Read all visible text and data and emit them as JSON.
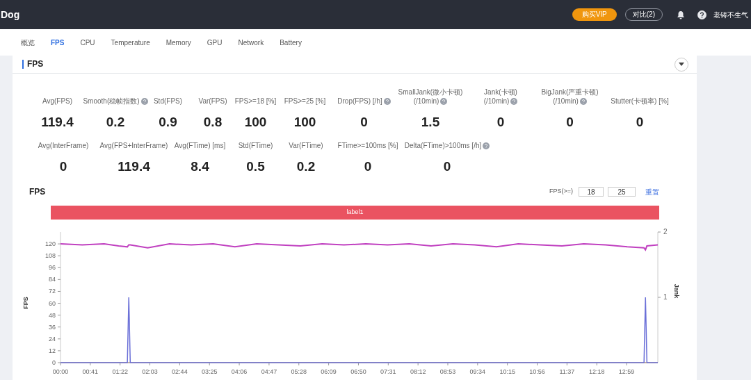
{
  "header": {
    "logo": "Dog",
    "buy_button": "购买VIP",
    "compare_button": "对比(2)",
    "user": "老铸不生气"
  },
  "tabs": [
    {
      "label": "概览",
      "selected": false
    },
    {
      "label": "FPS",
      "selected": true
    },
    {
      "label": "CPU",
      "selected": false
    },
    {
      "label": "Temperature",
      "selected": false
    },
    {
      "label": "Memory",
      "selected": false
    },
    {
      "label": "GPU",
      "selected": false
    },
    {
      "label": "Network",
      "selected": false
    },
    {
      "label": "Battery",
      "selected": false
    }
  ],
  "section": {
    "title": "FPS"
  },
  "stats_row_1": [
    {
      "label": "Avg(FPS)",
      "value": "119.4",
      "help": false
    },
    {
      "label": "Smooth(稳帧指数)",
      "value": "0.2",
      "help": true
    },
    {
      "label": "Std(FPS)",
      "value": "0.9",
      "help": false
    },
    {
      "label": "Var(FPS)",
      "value": "0.8",
      "help": false
    },
    {
      "label": "FPS>=18 [%]",
      "value": "100",
      "help": false
    },
    {
      "label": "FPS>=25 [%]",
      "value": "100",
      "help": false
    },
    {
      "label": "Drop(FPS) [/h]",
      "value": "0",
      "help": true
    },
    {
      "label": "SmallJank(微小卡顿)",
      "label_2": "(/10min)",
      "value": "1.5",
      "help": true
    },
    {
      "label": "Jank(卡顿)",
      "label_2": "(/10min)",
      "value": "0",
      "help": true
    },
    {
      "label": "BigJank(严重卡顿)",
      "label_2": "(/10min)",
      "value": "0",
      "help": true
    },
    {
      "label": "Stutter(卡顿率) [%]",
      "value": "0",
      "help": false
    }
  ],
  "stats_row_2": [
    {
      "label": "Avg(InterFrame)",
      "value": "0",
      "help": false
    },
    {
      "label": "Avg(FPS+InterFrame)",
      "value": "119.4",
      "help": false
    },
    {
      "label": "Avg(FTime) [ms]",
      "value": "8.4",
      "help": false
    },
    {
      "label": "Std(FTime)",
      "value": "0.5",
      "help": false
    },
    {
      "label": "Var(FTime)",
      "value": "0.2",
      "help": false
    },
    {
      "label": "FTime>=100ms [%]",
      "value": "0",
      "help": false
    },
    {
      "label": "Delta(FTime)>100ms [/h]",
      "value": "0",
      "help": true
    }
  ],
  "chart": {
    "title": "FPS",
    "threshold_label": "FPS(>=)",
    "threshold_1": "18",
    "threshold_2": "25",
    "reset_link": "重置",
    "label_bar": "label1",
    "chart_data": {
      "type": "line",
      "ylabel": "FPS",
      "y2label": "Jank",
      "ylim": [
        0,
        132
      ],
      "yticks": [
        0,
        12,
        24,
        36,
        48,
        60,
        72,
        84,
        96,
        108,
        120
      ],
      "y2ticks": [
        1,
        2
      ],
      "xticks": [
        {
          "value": 0,
          "label": "00:00"
        },
        {
          "value": 41,
          "label": "00:41"
        },
        {
          "value": 82,
          "label": "01:22"
        },
        {
          "value": 123,
          "label": "02:03"
        },
        {
          "value": 164,
          "label": "02:44"
        },
        {
          "value": 205,
          "label": "03:25"
        },
        {
          "value": 246,
          "label": "04:06"
        },
        {
          "value": 287,
          "label": "04:47"
        },
        {
          "value": 328,
          "label": "05:28"
        },
        {
          "value": 369,
          "label": "06:09"
        },
        {
          "value": 410,
          "label": "06:50"
        },
        {
          "value": 451,
          "label": "07:31"
        },
        {
          "value": 492,
          "label": "08:12"
        },
        {
          "value": 533,
          "label": "08:53"
        },
        {
          "value": 574,
          "label": "09:34"
        },
        {
          "value": 615,
          "label": "10:15"
        },
        {
          "value": 656,
          "label": "10:56"
        },
        {
          "value": 697,
          "label": "11:37"
        },
        {
          "value": 738,
          "label": "12:18"
        },
        {
          "value": 779,
          "label": "12:59"
        }
      ],
      "xlim": [
        0,
        822
      ],
      "y2lim": [
        0,
        2
      ],
      "x": [
        0,
        30,
        60,
        80,
        92,
        94,
        96,
        120,
        150,
        180,
        210,
        240,
        270,
        300,
        330,
        360,
        390,
        420,
        450,
        480,
        510,
        540,
        570,
        600,
        630,
        660,
        690,
        720,
        750,
        780,
        803,
        805,
        807,
        822
      ],
      "series": [
        {
          "color": "#c040c0",
          "values": [
            120,
            119,
            120,
            118,
            117,
            119,
            119,
            116,
            120,
            119,
            120,
            117,
            120,
            119,
            118,
            120,
            119,
            120,
            119,
            120,
            118,
            120,
            119,
            117,
            120,
            119,
            118,
            120,
            119,
            117,
            116,
            114,
            118,
            119
          ]
        },
        {
          "color": "#6b70d8",
          "axis": "y2",
          "values": [
            0,
            0,
            0,
            0,
            0,
            1,
            0,
            0,
            0,
            0,
            0,
            0,
            0,
            0,
            0,
            0,
            0,
            0,
            0,
            0,
            0,
            0,
            0,
            0,
            0,
            0,
            0,
            0,
            0,
            0,
            0,
            1,
            0,
            0
          ]
        }
      ]
    }
  }
}
